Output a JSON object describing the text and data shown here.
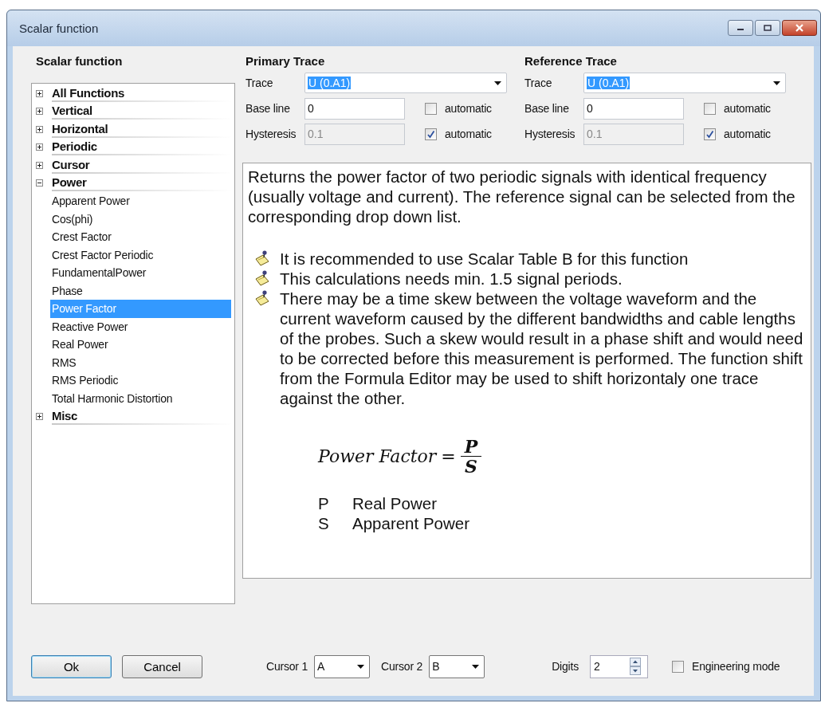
{
  "window": {
    "title": "Scalar function"
  },
  "tree": {
    "heading": "Scalar function",
    "items": [
      {
        "label": "All Functions",
        "expanded": false
      },
      {
        "label": "Vertical",
        "expanded": false
      },
      {
        "label": "Horizontal",
        "expanded": false
      },
      {
        "label": "Periodic",
        "expanded": false
      },
      {
        "label": "Cursor",
        "expanded": false
      },
      {
        "label": "Power",
        "expanded": true,
        "children": [
          {
            "label": "Apparent Power",
            "selected": false
          },
          {
            "label": "Cos(phi)",
            "selected": false
          },
          {
            "label": "Crest Factor",
            "selected": false
          },
          {
            "label": "Crest Factor Periodic",
            "selected": false
          },
          {
            "label": "FundamentalPower",
            "selected": false
          },
          {
            "label": "Phase",
            "selected": false
          },
          {
            "label": "Power Factor",
            "selected": true
          },
          {
            "label": "Reactive Power",
            "selected": false
          },
          {
            "label": "Real Power",
            "selected": false
          },
          {
            "label": "RMS",
            "selected": false
          },
          {
            "label": "RMS Periodic",
            "selected": false
          },
          {
            "label": "Total Harmonic Distortion",
            "selected": false
          }
        ]
      },
      {
        "label": "Misc",
        "expanded": false
      }
    ]
  },
  "traces": [
    {
      "heading": "Primary Trace",
      "trace": {
        "label": "Trace",
        "value": "U (0.A1)"
      },
      "base_line": {
        "label": "Base line",
        "value": "0",
        "disabled": false,
        "auto_label": "automatic",
        "auto_checked": false
      },
      "hysteresis": {
        "label": "Hysteresis",
        "value": "0.1",
        "disabled": true,
        "auto_label": "automatic",
        "auto_checked": true
      }
    },
    {
      "heading": "Reference Trace",
      "trace": {
        "label": "Trace",
        "value": "U (0.A1)"
      },
      "base_line": {
        "label": "Base line",
        "value": "0",
        "disabled": false,
        "auto_label": "automatic",
        "auto_checked": false
      },
      "hysteresis": {
        "label": "Hysteresis",
        "value": "0.1",
        "disabled": true,
        "auto_label": "automatic",
        "auto_checked": true
      }
    }
  ],
  "description": {
    "intro": "Returns the power factor of two periodic signals with identical frequency (usually voltage and current). The reference signal can be selected from the corresponding drop down list.",
    "notes": [
      "It is recommended to use Scalar Table B for this function",
      "This calculations needs min. 1.5 signal periods.",
      "There may be a time skew between the voltage waveform and the current waveform caused by the different bandwidths and cable lengths of the probes. Such a skew would result in a phase shift and would need to be corrected before this measurement is performed. The function shift from the Formula Editor may be used to shift horizontaly one trace against the other."
    ],
    "formula": {
      "lhs": "Power Factor",
      "equals": "=",
      "numerator": "P",
      "denominator": "S"
    },
    "legend": [
      {
        "symbol": "P",
        "meaning": "Real Power"
      },
      {
        "symbol": "S",
        "meaning": "Apparent Power"
      }
    ]
  },
  "footer": {
    "ok": "Ok",
    "cancel": "Cancel",
    "cursor1": {
      "label": "Cursor 1",
      "value": "A"
    },
    "cursor2": {
      "label": "Cursor 2",
      "value": "B"
    },
    "digits": {
      "label": "Digits",
      "value": "2"
    },
    "engineering_mode": {
      "label": "Engineering mode",
      "checked": false
    }
  }
}
